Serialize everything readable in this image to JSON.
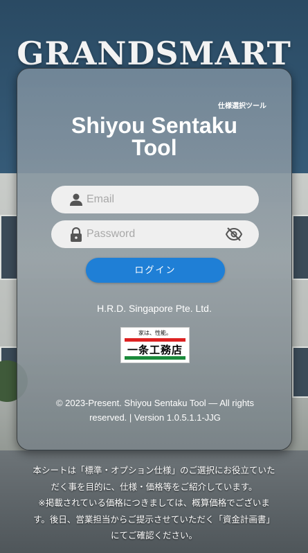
{
  "brand": {
    "title": "GRANDSMART"
  },
  "card": {
    "tag": "仕様選択ツール",
    "title_line1": "Shiyou Sentaku",
    "title_line2": "Tool"
  },
  "form": {
    "email_placeholder": "Email",
    "password_placeholder": "Password",
    "login_label": "ログイン"
  },
  "company": "H.R.D. Singapore Pte. Ltd.",
  "logo": {
    "slogan": "家は、性能。",
    "name": "一条工務店"
  },
  "footer": {
    "line1": "© 2023-Present. Shiyou Sentaku Tool — All rights",
    "line2": "reserved. | Version 1.0.5.1.1-JJG"
  },
  "notice": {
    "line1": "本シートは「標準・オプション仕様」のご選択にお役立ていた",
    "line2": "だく事を目的に、仕様・価格等をご紹介しています。",
    "line3": "※掲載されている価格につきましては、概算価格でございま",
    "line4": "す。後日、営業担当からご提示させていただく「資金計画書」",
    "line5": "にてご確認ください。"
  },
  "colors": {
    "accent": "#1f7fd6",
    "logo_red": "#dd2222",
    "logo_green": "#1a8a3a"
  },
  "icons": [
    "person-icon",
    "lock-icon",
    "eye-slash-icon"
  ]
}
